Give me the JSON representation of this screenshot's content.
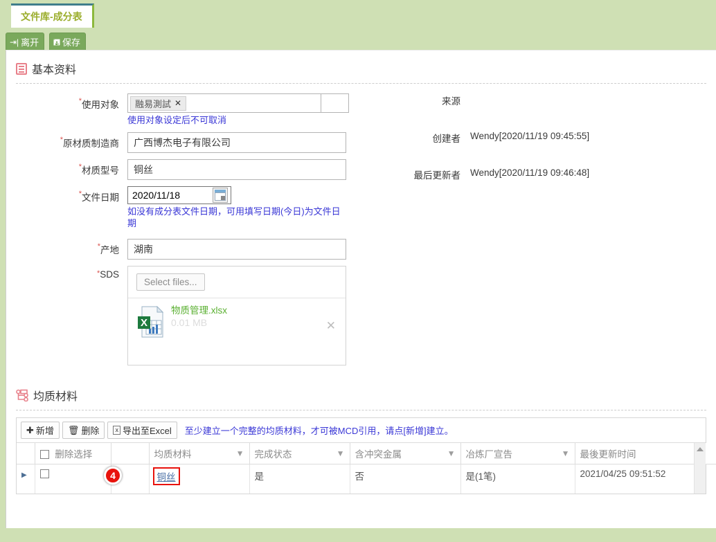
{
  "tab": {
    "label": "文件库-成分表"
  },
  "toolbar": {
    "leave_label": "离开",
    "leave_icon": "exit-icon",
    "save_label": "保存",
    "save_icon": "save-icon"
  },
  "basic_section": {
    "title": "基本资料",
    "icon": "list-icon",
    "fields": {
      "usage_object": {
        "label": "使用对象",
        "required": "*",
        "tag": "融易測試",
        "tag_remove": "✕",
        "hint": "使用对象设定后不可取消"
      },
      "manufacturer": {
        "label": "原材质制造商",
        "required": "*",
        "value": "广西博杰电子有限公司"
      },
      "model": {
        "label": "材质型号",
        "required": "*",
        "value": "铜丝"
      },
      "file_date": {
        "label": "文件日期",
        "required": "*",
        "value": "2020/11/18",
        "hint": "如没有成分表文件日期，可用填写日期(今日)为文件日期",
        "picker_icon": "calendar-icon"
      },
      "origin": {
        "label": "产地",
        "required": "*",
        "value": "湖南"
      },
      "sds": {
        "label": "SDS",
        "required": "*",
        "select_files_label": "Select files...",
        "file_name": "物质管理",
        "file_ext": ".xlsx",
        "file_size": "0.01 MB",
        "file_icon": "excel-file-icon",
        "remove_icon": "✕"
      }
    },
    "meta": [
      {
        "label": "来源",
        "value": ""
      },
      {
        "label": "创建者",
        "value": "Wendy[2020/11/19 09:45:55]"
      },
      {
        "label": "最后更新者",
        "value": "Wendy[2020/11/19 09:46:48]"
      }
    ]
  },
  "material_section": {
    "title": "均质材料",
    "icon": "tree-icon",
    "toolbar": {
      "add_label": "新增",
      "add_icon": "plus-icon",
      "delete_label": "删除",
      "delete_icon": "trash-icon",
      "export_label": "导出至Excel",
      "export_icon": "excel-export-icon",
      "note": "至少建立一个完整的均质材料，才可被MCD引用，请点[新增]建立。"
    },
    "table": {
      "columns": [
        {
          "label": "",
          "filter": false
        },
        {
          "label": "删除选择",
          "filter": false,
          "checkbox": true
        },
        {
          "label": "",
          "filter": false
        },
        {
          "label": "均质材料",
          "filter": true
        },
        {
          "label": "完成状态",
          "filter": true
        },
        {
          "label": "含冲突金属",
          "filter": true
        },
        {
          "label": "冶炼厂宣告",
          "filter": true
        },
        {
          "label": "最後更新时间",
          "filter": false
        }
      ],
      "rows": [
        {
          "expand_icon": "expand-arrow-icon",
          "selected": false,
          "material": "铜丝",
          "status": "是",
          "conflict_metal": "否",
          "smelter_declaration": "是(1笔)",
          "last_updated": "2021/04/25 09:51:52"
        }
      ]
    },
    "annotation_badge": "4"
  },
  "colors": {
    "page_background": "#cfe0b4",
    "tab_text": "#9aad2b",
    "tab_top_border": "#3f7d8c",
    "toolbar_button": "#7aa95c",
    "hint_text": "#3a37d6",
    "required": "#d9534f",
    "link": "#4a6fa5",
    "file_link": "#5ab031",
    "annotation": "#e8120c"
  }
}
